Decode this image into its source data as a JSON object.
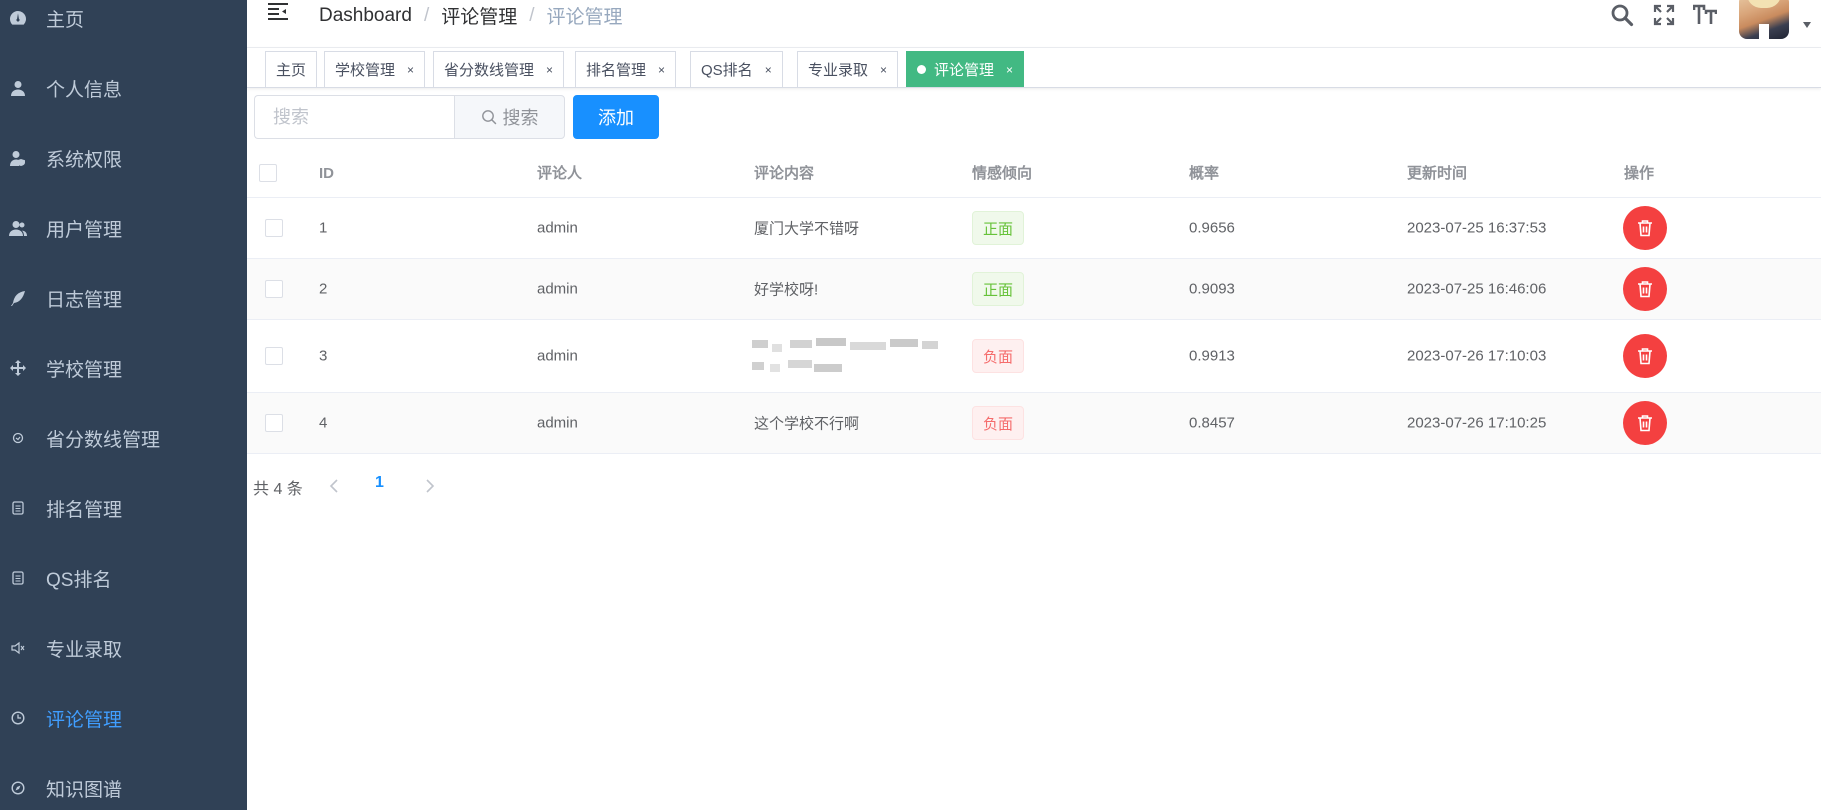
{
  "sidebar": {
    "items": [
      {
        "label": "主页",
        "icon": "dashboard-icon",
        "active": false
      },
      {
        "label": "个人信息",
        "icon": "user-icon",
        "active": false
      },
      {
        "label": "系统权限",
        "icon": "user-shield-icon",
        "active": false
      },
      {
        "label": "用户管理",
        "icon": "users-icon",
        "active": false
      },
      {
        "label": "日志管理",
        "icon": "feather-icon",
        "active": false
      },
      {
        "label": "学校管理",
        "icon": "move-arrows-icon",
        "active": false
      },
      {
        "label": "省分数线管理",
        "icon": "component-icon",
        "active": false
      },
      {
        "label": "排名管理",
        "icon": "document-icon",
        "active": false
      },
      {
        "label": "QS排名",
        "icon": "document-icon",
        "active": false
      },
      {
        "label": "专业录取",
        "icon": "speaker-icon",
        "active": false
      },
      {
        "label": "评论管理",
        "icon": "clock-icon",
        "active": true
      },
      {
        "label": "知识图谱",
        "icon": "compass-icon",
        "active": false
      }
    ]
  },
  "breadcrumb": [
    "Dashboard",
    "评论管理",
    "评论管理"
  ],
  "tags": [
    {
      "label": "主页",
      "closable": false,
      "active": false
    },
    {
      "label": "学校管理",
      "closable": true,
      "active": false
    },
    {
      "label": "省分数线管理",
      "closable": true,
      "active": false
    },
    {
      "label": "排名管理",
      "closable": true,
      "active": false
    },
    {
      "label": "QS排名",
      "closable": true,
      "active": false
    },
    {
      "label": "专业录取",
      "closable": true,
      "active": false
    },
    {
      "label": "评论管理",
      "closable": true,
      "active": true
    }
  ],
  "tag_close": "×",
  "toolbar": {
    "search_placeholder": "搜索",
    "search_label": "搜索",
    "add_label": "添加"
  },
  "table": {
    "headers": [
      "ID",
      "评论人",
      "评论内容",
      "情感倾向",
      "概率",
      "更新时间",
      "操作"
    ],
    "rows": [
      {
        "id": "1",
        "user": "admin",
        "content": "厦门大学不错呀",
        "sentiment": "正面",
        "polarity": "positive",
        "prob": "0.9656",
        "time": "2023-07-25 16:37:53"
      },
      {
        "id": "2",
        "user": "admin",
        "content": "好学校呀!",
        "sentiment": "正面",
        "polarity": "positive",
        "prob": "0.9093",
        "time": "2023-07-25 16:46:06"
      },
      {
        "id": "3",
        "user": "admin",
        "content": "",
        "sentiment": "负面",
        "polarity": "negative",
        "prob": "0.9913",
        "time": "2023-07-26 17:10:03"
      },
      {
        "id": "4",
        "user": "admin",
        "content": "这个学校不行啊",
        "sentiment": "负面",
        "polarity": "negative",
        "prob": "0.8457",
        "time": "2023-07-26 17:10:25"
      }
    ]
  },
  "pagination": {
    "total_label": "共 4 条",
    "current_page": "1"
  },
  "colors": {
    "sidebar_bg": "#304156",
    "sidebar_text": "#bfcbd9",
    "active": "#409eff",
    "primary": "#1890ff",
    "tag_active": "#42b983",
    "danger": "#f44040"
  }
}
